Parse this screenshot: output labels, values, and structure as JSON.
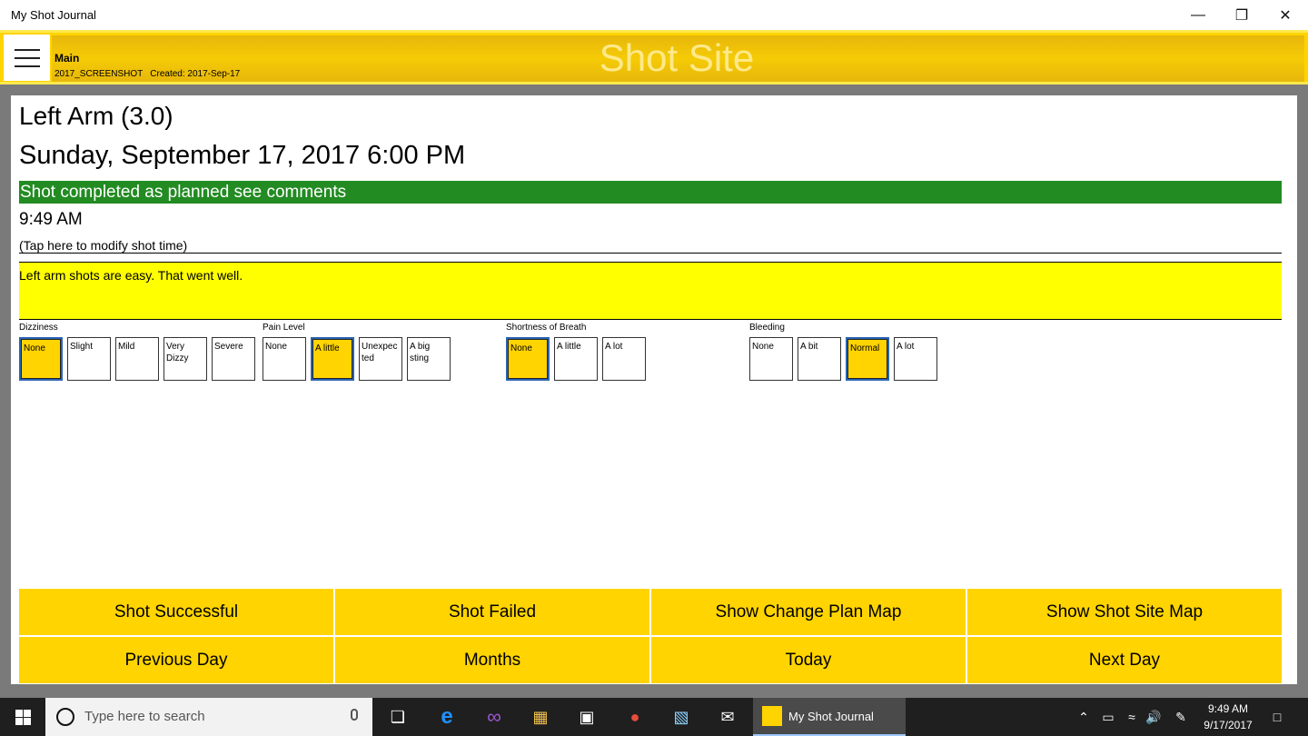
{
  "window": {
    "title": "My Shot Journal"
  },
  "header": {
    "main_label": "Main",
    "journal_name": "2017_SCREENSHOT",
    "created": "Created:  2017-Sep-17",
    "page_title": "Shot Site"
  },
  "shot": {
    "site": "Left Arm (3.0)",
    "date": "Sunday, September 17, 2017 6:00 PM",
    "status": "Shot completed as planned see comments",
    "status_color": "#228b22",
    "time": "9:49 AM",
    "modify_hint": "(Tap here to modify shot time)",
    "comments": "Left arm shots are easy.  That went well."
  },
  "symptoms": [
    {
      "label": "Dizziness",
      "options": [
        "None",
        "Slight",
        "Mild",
        "Very Dizzy",
        "Severe"
      ],
      "selected": "None"
    },
    {
      "label": "Pain Level",
      "options": [
        "None",
        "A little",
        "Unexpected",
        "A big sting"
      ],
      "selected": "A little"
    },
    {
      "label": "Shortness of Breath",
      "options": [
        "None",
        "A little",
        "A lot"
      ],
      "selected": "None"
    },
    {
      "label": "Bleeding",
      "options": [
        "None",
        "A bit",
        "Normal",
        "A lot"
      ],
      "selected": "Normal"
    }
  ],
  "actions": {
    "shot_successful": "Shot Successful",
    "shot_failed": "Shot Failed",
    "show_change_plan_map": "Show Change Plan Map",
    "show_shot_site_map": "Show Shot Site Map",
    "previous_day": "Previous Day",
    "months": "Months",
    "today": "Today",
    "next_day": "Next Day"
  },
  "taskbar": {
    "search_placeholder": "Type here to search",
    "active_app": "My Shot Journal",
    "time": "9:49 AM",
    "date": "9/17/2017"
  },
  "colors": {
    "accent_yellow": "#ffd400",
    "comment_yellow": "#ffff00",
    "selection_border": "#2a64b4"
  }
}
